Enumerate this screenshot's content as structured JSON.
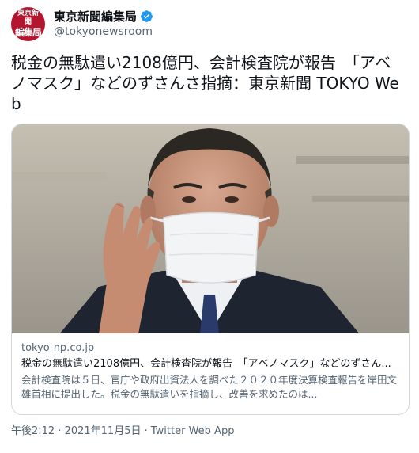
{
  "author": {
    "avatar_text_line1": "東京新聞",
    "avatar_text_line2": "編集局",
    "display_name": "東京新聞編集局",
    "handle": "@tokyonewsroom",
    "verified": true
  },
  "tweet": {
    "text": "税金の無駄遣い2108億円、会計検査院が報告　「アベノマスク」などのずさんさ指摘：東京新聞 TOKYO Web",
    "timestamp": "午後2:12 · 2021年11月5日 · Twitter Web App"
  },
  "card": {
    "domain": "tokyo-np.co.jp",
    "title": "税金の無駄遣い2108億円、会計検査院が報告　「アベノマスク」などのずさん...",
    "description": "会計検査院は５日、官庁や政府出資法人を調べた２０２０年度決算検査報告を岸田文雄首相に提出した。税金の無駄遣いを指摘し、改善を求めたのは..."
  },
  "colors": {
    "avatar_bg": "#b3152e",
    "verified_blue": "#1d9bf0",
    "secondary_text": "#536471",
    "border": "#cfd9de"
  },
  "icons": {
    "verified": "verified-badge-icon"
  }
}
